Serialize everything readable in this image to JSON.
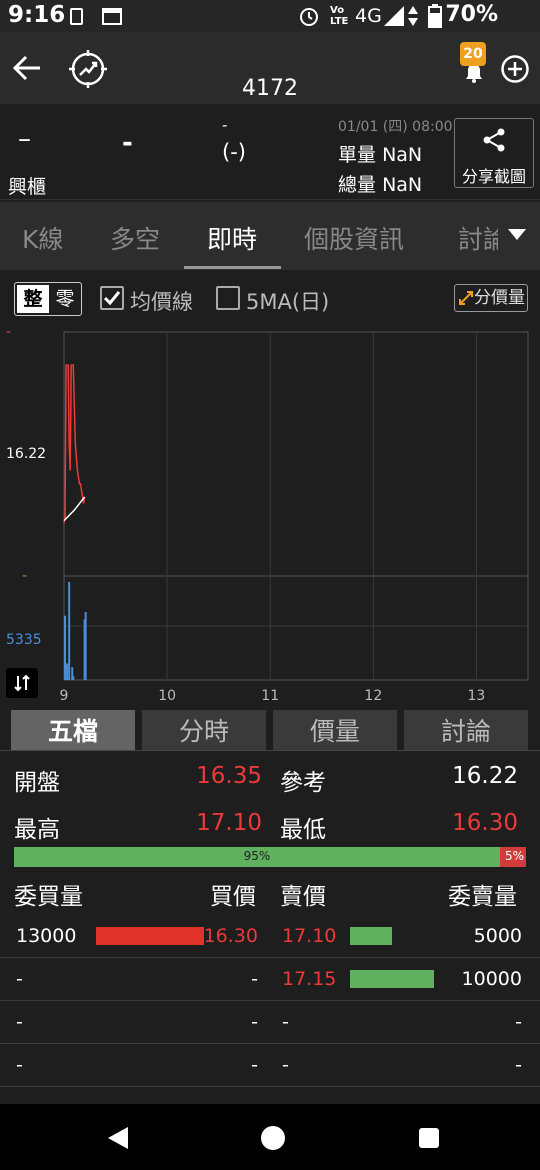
{
  "status_bar": {
    "time": "9:16",
    "network": "4G",
    "battery": "70%"
  },
  "header": {
    "stock_code": "4172",
    "notification_count": "20"
  },
  "quote": {
    "price": "–",
    "change": "-",
    "pct_top": "-",
    "pct": "(-)",
    "market": "興櫃",
    "datetime": "01/01 (四) 08:00",
    "single_vol_label": "單量",
    "single_vol_value": "NaN",
    "total_vol_label": "總量",
    "total_vol_value": "NaN",
    "share_label": "分享截圖"
  },
  "tabs": [
    "K線",
    "多空",
    "即時",
    "個股資訊",
    "討論"
  ],
  "toolbar": {
    "seg_whole": "整",
    "seg_odd": "零",
    "avg_line_label": "均價線",
    "ma5_label": "5MA(日)",
    "fenjia_label": "分價量"
  },
  "chart_data": {
    "type": "line",
    "y_top_tick": "-",
    "y_mid_tick": "16.22",
    "y_bottom_tick": "-",
    "volume_tick": "5335",
    "x_ticks": [
      "9",
      "10",
      "11",
      "12",
      "13"
    ],
    "x_range": [
      9,
      13.5
    ],
    "y_range": [
      15.5,
      17.2
    ],
    "volume_range": [
      0,
      5335
    ],
    "series": [
      {
        "role": "price",
        "color": "#ea3a3a",
        "x": [
          9.0,
          9.01,
          9.02,
          9.03,
          9.04,
          9.05,
          9.06,
          9.07,
          9.08,
          9.09,
          9.1,
          9.11,
          9.12,
          9.13,
          9.14,
          9.15,
          9.16,
          9.17,
          9.18,
          9.19,
          9.2
        ],
        "y": [
          15.9,
          15.95,
          17.1,
          17.1,
          17.1,
          16.5,
          16.3,
          17.1,
          17.1,
          17.1,
          16.8,
          16.5,
          16.4,
          16.3,
          16.25,
          16.2,
          16.2,
          16.15,
          16.1,
          16.05,
          16.1
        ]
      },
      {
        "role": "average",
        "color": "#ffffff",
        "x": [
          9.0,
          9.05,
          9.1,
          9.15,
          9.2
        ],
        "y": [
          15.92,
          15.96,
          16.0,
          16.05,
          16.1
        ]
      }
    ],
    "volume": {
      "color": "#4a90d9",
      "x": [
        9.01,
        9.03,
        9.05,
        9.08,
        9.09,
        9.2,
        9.21
      ],
      "v": [
        3500,
        900,
        5335,
        700,
        200,
        3300,
        3700
      ]
    }
  },
  "bottom_tabs": [
    "五檔",
    "分時",
    "價量",
    "討論"
  ],
  "summary": {
    "open_label": "開盤",
    "open_value": "16.35",
    "ref_label": "參考",
    "ref_value": "16.22",
    "high_label": "最高",
    "high_value": "17.10",
    "low_label": "最低",
    "low_value": "16.30",
    "bar_left_pct": "95%",
    "bar_right_pct": "5%",
    "bar_left_fraction": 0.95,
    "col_bid_qty": "委買量",
    "col_bid_price": "買價",
    "col_ask_price": "賣價",
    "col_ask_qty": "委賣量",
    "rows": [
      {
        "bid_qty": "13000",
        "bid_price": "16.30",
        "ask_price": "17.10",
        "ask_qty": "5000",
        "bid_bar": 1.0,
        "ask_bar": 0.5
      },
      {
        "bid_qty": "-",
        "bid_price": "-",
        "ask_price": "17.15",
        "ask_qty": "10000",
        "bid_bar": 0,
        "ask_bar": 1.0
      },
      {
        "bid_qty": "-",
        "bid_price": "-",
        "ask_price": "-",
        "ask_qty": "-",
        "bid_bar": 0,
        "ask_bar": 0
      },
      {
        "bid_qty": "-",
        "bid_price": "-",
        "ask_price": "-",
        "ask_qty": "-",
        "bid_bar": 0,
        "ask_bar": 0
      }
    ]
  }
}
